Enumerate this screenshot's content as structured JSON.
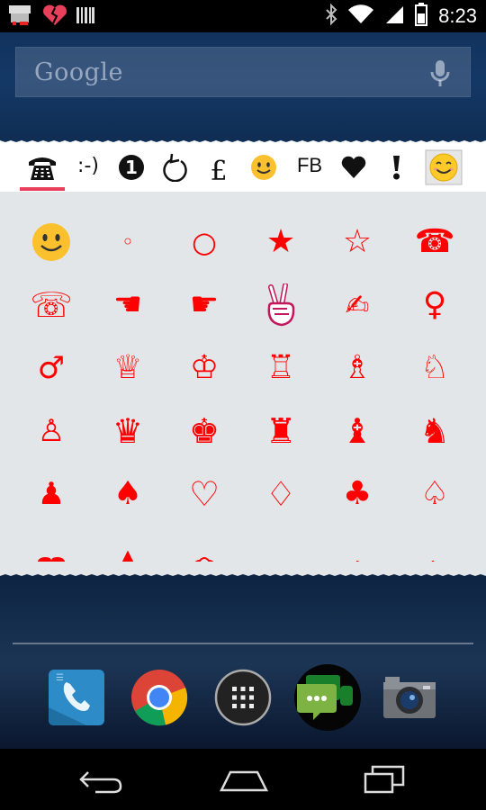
{
  "status_bar": {
    "time": "8:23",
    "left_icons": [
      "notification-icon",
      "broken-heart-icon",
      "barcode-icon"
    ],
    "right_icons": [
      "bluetooth-icon",
      "wifi-icon",
      "signal-icon",
      "battery-icon"
    ]
  },
  "search": {
    "label": "Google",
    "mic_icon": "mic-icon"
  },
  "keyboard": {
    "tabs": [
      {
        "id": "phone",
        "label": "☎",
        "icon": "telephone-icon",
        "selected": true
      },
      {
        "id": "emoticon",
        "label": ":-)",
        "icon": "emoticon-text"
      },
      {
        "id": "number",
        "label": "❶",
        "icon": "number-one-icon"
      },
      {
        "id": "arrow",
        "label": "↺",
        "icon": "circle-arrow-icon"
      },
      {
        "id": "currency",
        "label": "£",
        "icon": "pound-icon"
      },
      {
        "id": "smiley",
        "label": "",
        "icon": "smiley-icon"
      },
      {
        "id": "fb",
        "label": "FB",
        "icon": "fb-text"
      },
      {
        "id": "heart",
        "label": "♥",
        "icon": "heart-icon"
      },
      {
        "id": "exclaim",
        "label": "❢",
        "icon": "exclamation-icon"
      },
      {
        "id": "settings",
        "label": "",
        "icon": "smiley-button-icon"
      }
    ],
    "accent_color": "#e8405a",
    "symbol_color": "#ff0000",
    "symbols": [
      [
        "smiley",
        "◦",
        "○",
        "★",
        "☆",
        "☎"
      ],
      [
        "☏",
        "☚",
        "☛",
        "✌",
        "✍",
        "♀"
      ],
      [
        "♂",
        "♕",
        "♔",
        "♖",
        "♗",
        "♘"
      ],
      [
        "♙",
        "♛",
        "♚",
        "♜",
        "♝",
        "♞"
      ],
      [
        "♟",
        "♠",
        "♡",
        "♢",
        "♣",
        "♤"
      ],
      [
        "▬",
        "▲",
        "⌒",
        "⁅",
        "╷",
        "ʌ"
      ]
    ]
  },
  "dock": {
    "apps": [
      {
        "name": "Phone",
        "icon": "phone-app-icon"
      },
      {
        "name": "Chrome",
        "icon": "chrome-icon"
      },
      {
        "name": "Apps",
        "icon": "app-drawer-icon"
      },
      {
        "name": "Hangouts",
        "icon": "hangouts-icon"
      },
      {
        "name": "Camera",
        "icon": "camera-icon"
      }
    ]
  },
  "nav": [
    "back-icon",
    "home-icon",
    "recents-icon"
  ]
}
